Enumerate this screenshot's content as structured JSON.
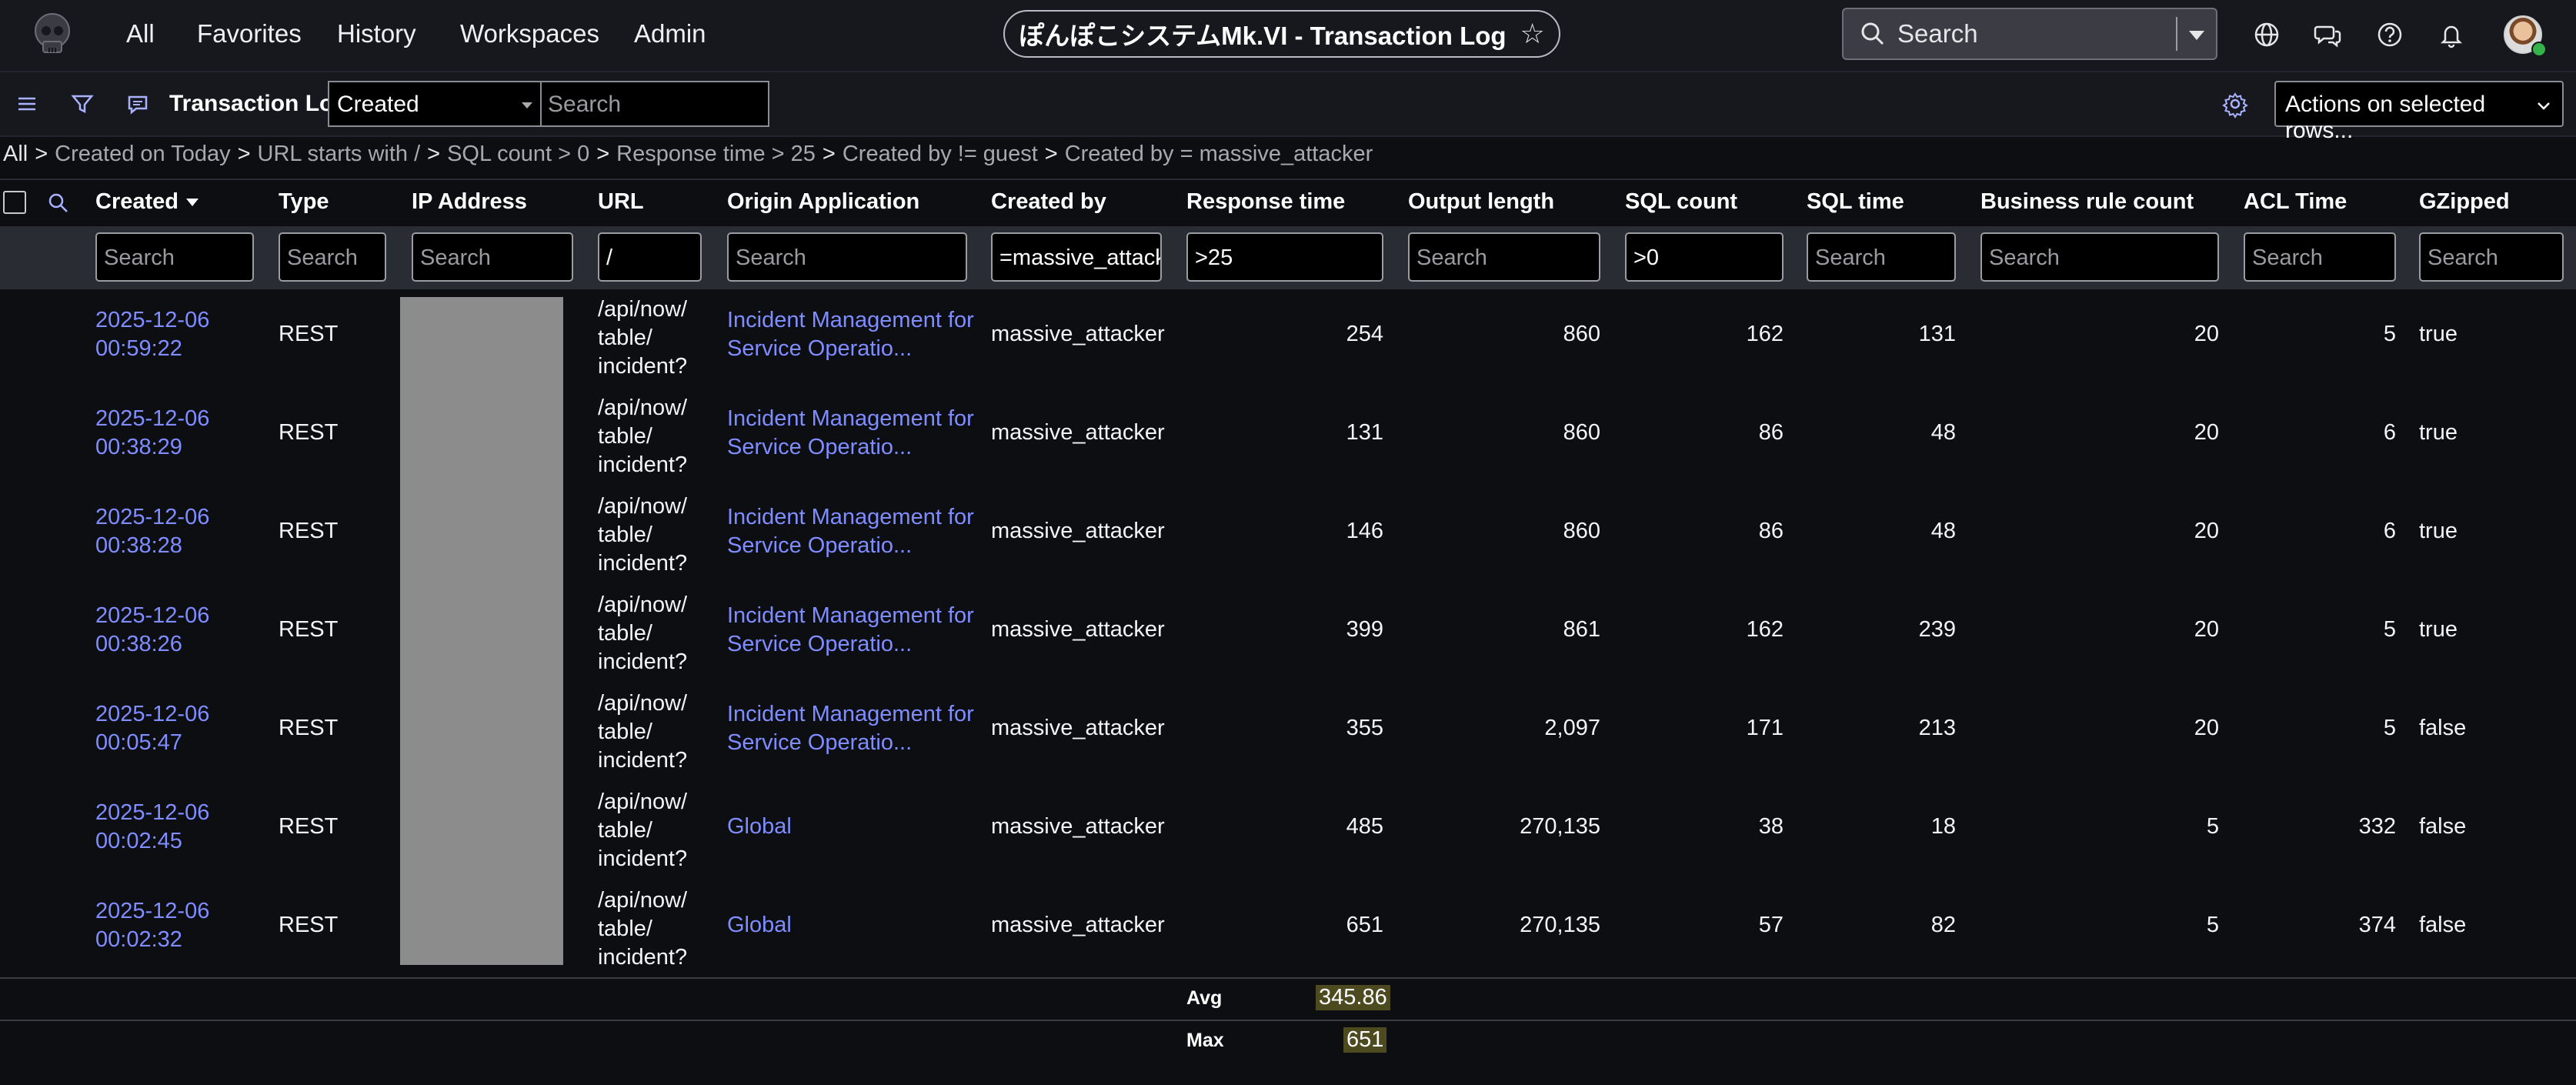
{
  "topnav": {
    "items": [
      "All",
      "Favorites",
      "History",
      "Workspaces",
      "Admin"
    ],
    "title": "ぽんぽこシステムMk.VI - Transaction Log",
    "search_placeholder": "Search",
    "icons": [
      "globe-icon",
      "chat-icon",
      "help-icon",
      "bell-icon"
    ]
  },
  "toolbar": {
    "title": "Transaction Log",
    "field_select": "Created",
    "search_placeholder": "Search",
    "actions_label": "Actions on selected rows..."
  },
  "breadcrumb": [
    "All",
    "Created on Today",
    "URL starts with /",
    "SQL count > 0",
    "Response time > 25",
    "Created by != guest",
    "Created by = massive_attacker"
  ],
  "columns": {
    "created": "Created",
    "type": "Type",
    "ip": "IP Address",
    "url": "URL",
    "origin": "Origin Application",
    "created_by": "Created by",
    "response_time": "Response time",
    "output_length": "Output length",
    "sql_count": "SQL count",
    "sql_time": "SQL time",
    "br_count": "Business rule count",
    "acl_time": "ACL Time",
    "gzipped": "GZipped"
  },
  "filters": {
    "created": "Search",
    "type": "Search",
    "ip": "Search",
    "url": "/",
    "origin": "Search",
    "created_by": "=massive_attacker",
    "response_time": ">25",
    "output_length": "Search",
    "sql_count": ">0",
    "sql_time": "Search",
    "br_count": "Search",
    "acl_time": "Search",
    "gzipped": "Search"
  },
  "rows": [
    {
      "date": "2025-12-06",
      "time": "00:59:22",
      "type": "REST",
      "url1": "/api/now/",
      "url2": "table/",
      "url3": "incident?",
      "origin1": "Incident Management for",
      "origin2": "Service Operatio...",
      "created_by": "massive_attacker",
      "response_time": "254",
      "output_length": "860",
      "sql_count": "162",
      "sql_time": "131",
      "br_count": "20",
      "acl_time": "5",
      "gzipped": "true"
    },
    {
      "date": "2025-12-06",
      "time": "00:38:29",
      "type": "REST",
      "url1": "/api/now/",
      "url2": "table/",
      "url3": "incident?",
      "origin1": "Incident Management for",
      "origin2": "Service Operatio...",
      "created_by": "massive_attacker",
      "response_time": "131",
      "output_length": "860",
      "sql_count": "86",
      "sql_time": "48",
      "br_count": "20",
      "acl_time": "6",
      "gzipped": "true"
    },
    {
      "date": "2025-12-06",
      "time": "00:38:28",
      "type": "REST",
      "url1": "/api/now/",
      "url2": "table/",
      "url3": "incident?",
      "origin1": "Incident Management for",
      "origin2": "Service Operatio...",
      "created_by": "massive_attacker",
      "response_time": "146",
      "output_length": "860",
      "sql_count": "86",
      "sql_time": "48",
      "br_count": "20",
      "acl_time": "6",
      "gzipped": "true"
    },
    {
      "date": "2025-12-06",
      "time": "00:38:26",
      "type": "REST",
      "url1": "/api/now/",
      "url2": "table/",
      "url3": "incident?",
      "origin1": "Incident Management for",
      "origin2": "Service Operatio...",
      "created_by": "massive_attacker",
      "response_time": "399",
      "output_length": "861",
      "sql_count": "162",
      "sql_time": "239",
      "br_count": "20",
      "acl_time": "5",
      "gzipped": "true"
    },
    {
      "date": "2025-12-06",
      "time": "00:05:47",
      "type": "REST",
      "url1": "/api/now/",
      "url2": "table/",
      "url3": "incident?",
      "origin1": "Incident Management for",
      "origin2": "Service Operatio...",
      "created_by": "massive_attacker",
      "response_time": "355",
      "output_length": "2,097",
      "sql_count": "171",
      "sql_time": "213",
      "br_count": "20",
      "acl_time": "5",
      "gzipped": "false"
    },
    {
      "date": "2025-12-06",
      "time": "00:02:45",
      "type": "REST",
      "url1": "/api/now/",
      "url2": "table/",
      "url3": "incident?",
      "origin1": "Global",
      "origin2": "",
      "created_by": "massive_attacker",
      "response_time": "485",
      "output_length": "270,135",
      "sql_count": "38",
      "sql_time": "18",
      "br_count": "5",
      "acl_time": "332",
      "gzipped": "false"
    },
    {
      "date": "2025-12-06",
      "time": "00:02:32",
      "type": "REST",
      "url1": "/api/now/",
      "url2": "table/",
      "url3": "incident?",
      "origin1": "Global",
      "origin2": "",
      "created_by": "massive_attacker",
      "response_time": "651",
      "output_length": "270,135",
      "sql_count": "57",
      "sql_time": "82",
      "br_count": "5",
      "acl_time": "374",
      "gzipped": "false"
    }
  ],
  "aggregates": {
    "avg_label": "Avg",
    "avg_value": "345.86",
    "max_label": "Max",
    "max_value": "651"
  }
}
